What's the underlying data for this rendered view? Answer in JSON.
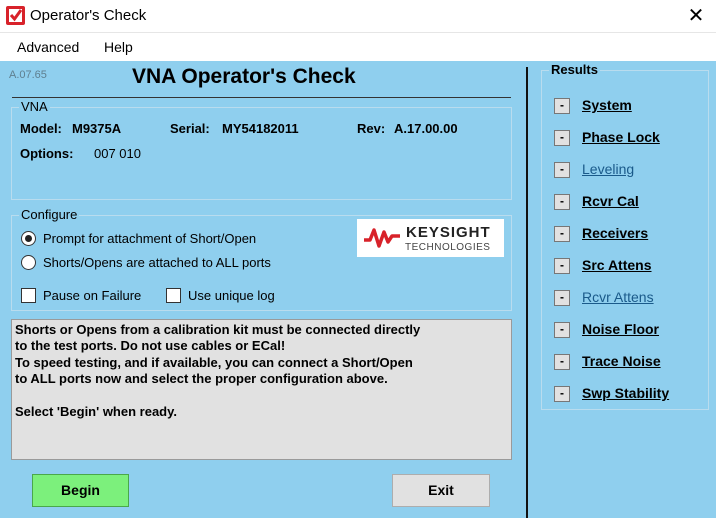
{
  "window": {
    "title": "Operator's Check",
    "close_glyph": "✕",
    "app_icon": "check-mark-icon"
  },
  "menu": [
    {
      "label": "Advanced"
    },
    {
      "label": "Help"
    }
  ],
  "version": "A.07.65",
  "heading": "VNA Operator's Check",
  "vna": {
    "group_label": "VNA",
    "model_label": "Model:",
    "model_value": "M9375A",
    "serial_label": "Serial:",
    "serial_value": "MY54182011",
    "rev_label": "Rev:",
    "rev_value": "A.17.00.00",
    "options_label": "Options:",
    "options_value": "007 010"
  },
  "configure": {
    "group_label": "Configure",
    "radio_prompt": "Prompt for attachment of Short/Open",
    "radio_all": "Shorts/Opens are attached to ALL ports",
    "selected": "radio_prompt",
    "check_pause": "Pause on Failure",
    "check_log": "Use unique log"
  },
  "logo": {
    "word": "KEYSIGHT",
    "sub": "TECHNOLOGIES"
  },
  "message": {
    "line1": "Shorts or Opens from a calibration kit must be connected directly",
    "line2": "to the test ports. Do not use cables or ECal!",
    "line3": "To speed testing, and if available, you can connect a Short/Open",
    "line4": "to ALL ports now and select the proper configuration above.",
    "line5": "Select 'Begin' when ready."
  },
  "buttons": {
    "begin": "Begin",
    "exit": "Exit"
  },
  "results": {
    "title": "Results",
    "items": [
      {
        "indicator": "-",
        "label": "System"
      },
      {
        "indicator": "-",
        "label": "Phase Lock"
      },
      {
        "indicator": "-",
        "label": "Leveling"
      },
      {
        "indicator": "-",
        "label": "Rcvr Cal"
      },
      {
        "indicator": "-",
        "label": "Receivers"
      },
      {
        "indicator": "-",
        "label": "Src Attens"
      },
      {
        "indicator": "-",
        "label": "Rcvr Attens"
      },
      {
        "indicator": "-",
        "label": "Noise Floor"
      },
      {
        "indicator": "-",
        "label": "Trace Noise"
      },
      {
        "indicator": "-",
        "label": "Swp Stability"
      }
    ]
  },
  "colors": {
    "client_bg": "#8fcfee",
    "begin_bg": "#7cf07c",
    "exit_bg": "#e1e1e1",
    "link_dark": "#000000",
    "link_blue": "#1a5a8a",
    "logo_red": "#d8222a"
  }
}
